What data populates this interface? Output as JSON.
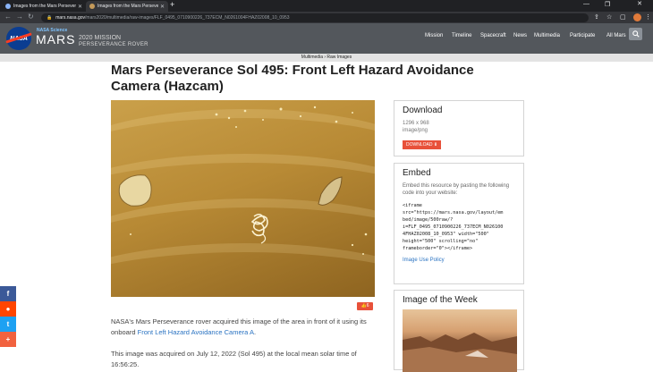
{
  "browser": {
    "tabs": [
      {
        "title": "Images from the Mars Perseverance"
      },
      {
        "title": "Images from the Mars Perseverance"
      }
    ],
    "new_tab": "+",
    "url_domain": "mars.nasa.gov",
    "url_path": "/mars2020/multimedia/raw-images/FLF_0495_0710900226_737ECM_N0261004FHAZ02008_10_0953"
  },
  "site": {
    "logo_text": "NASA",
    "science_label": "NASA Science",
    "mars_label": "MARS",
    "mission_line1": "2020 MISSION",
    "mission_line2": "PERSEVERANCE ROVER",
    "nav": [
      "Mission",
      "Timeline",
      "Spacecraft",
      "News",
      "Multimedia",
      "Participate",
      "All Mars"
    ]
  },
  "breadcrumb": "Multimedia › Raw Images",
  "page_title": "Mars Perseverance Sol 495: Front Left Hazard Avoidance Camera (Hazcam)",
  "image_counter": "6",
  "body": {
    "p1_before": "NASA's Mars Perseverance rover acquired this image of the area in front of it using its onboard ",
    "p1_link": "Front Left Hazard Avoidance Camera A",
    "p1_after": ".",
    "p2": "This image was acquired on July 12, 2022 (Sol 495) at the local mean solar time of 16:56:25."
  },
  "download": {
    "heading": "Download",
    "dimensions": "1296 x 968",
    "format": "image/png",
    "button": "DOWNLOAD"
  },
  "embed": {
    "heading": "Embed",
    "description": "Embed this resource by pasting the following code into your website:",
    "code": "<iframe\nsrc=\"https://mars.nasa.gov/layout/em\nbed/image/500raw/?\ni=FLF_0495_0710900226_737ECM_N026100\n4FHAZ02008_10_0953\" width=\"500\"\nheight=\"500\" scrolling=\"no\"\nframeborder=\"0\"></iframe>",
    "policy_link": "Image Use Policy"
  },
  "iotw": {
    "heading": "Image of the Week"
  },
  "share": [
    {
      "icon": "facebook-icon",
      "glyph": "f",
      "color": "#3b5998"
    },
    {
      "icon": "reddit-icon",
      "glyph": "●",
      "color": "#ff4500"
    },
    {
      "icon": "twitter-icon",
      "glyph": "t",
      "color": "#1da1f2"
    },
    {
      "icon": "more-share-icon",
      "glyph": "+",
      "color": "#f1623f"
    }
  ]
}
